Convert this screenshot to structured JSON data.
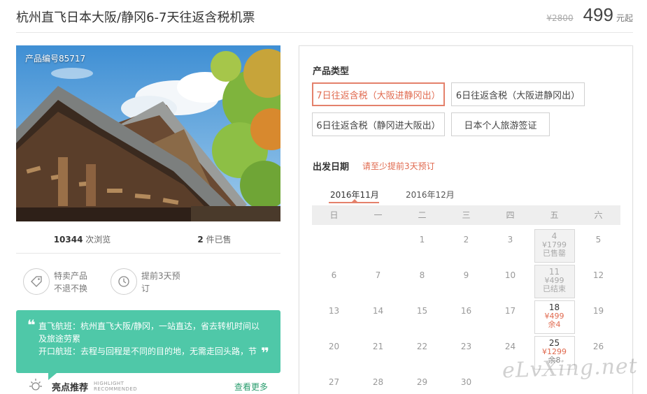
{
  "header": {
    "title": "杭州直飞日本大阪/静冈6-7天往返含税机票",
    "original_price": "¥2800",
    "price": "499",
    "price_unit": "元起"
  },
  "product": {
    "code": "产品编号85717",
    "views_count": "10344",
    "views_label": "次浏览",
    "sold_count": "2",
    "sold_label": "件已售"
  },
  "features": [
    {
      "icon": "tag-icon",
      "line1": "特卖产品",
      "line2": "不退不换"
    },
    {
      "icon": "clock-icon",
      "line1": "提前3天预",
      "line2": "订"
    }
  ],
  "highlights": {
    "line1": "直飞航班：杭州直飞大阪/静冈，一站直达，省去转机时间以",
    "line2": "及旅途劳累",
    "line3": "开口航班：去程与回程是不同的目的地，无需走回头路，节",
    "quote_open": "❝",
    "quote_close": "❞"
  },
  "recommend": {
    "label": "亮点推荐",
    "sub1": "HIGHLIGHT",
    "sub2": "RECOMMENDED",
    "more": "查看更多"
  },
  "panel": {
    "product_type_label": "产品类型",
    "options": [
      {
        "label": "7日往返含税（大阪进静冈出）",
        "selected": true
      },
      {
        "label": "6日往返含税（大阪进静冈出）",
        "selected": false
      },
      {
        "label": "6日往返含税（静冈进大阪出）",
        "selected": false
      },
      {
        "label": "日本个人旅游签证",
        "selected": false
      }
    ],
    "departure_label": "出发日期",
    "departure_note": "请至少提前3天预订",
    "months": [
      "2016年11月",
      "2016年12月"
    ],
    "weekdays": [
      "日",
      "一",
      "二",
      "三",
      "四",
      "五",
      "六"
    ],
    "calendar": [
      {
        "day": "1"
      },
      {
        "day": "2"
      },
      {
        "day": "3"
      },
      {
        "day": "4",
        "price": "¥1799",
        "status": "已售罄",
        "state": "past"
      },
      {
        "day": "5"
      },
      {
        "day": "6"
      },
      {
        "day": "7"
      },
      {
        "day": "8"
      },
      {
        "day": "9"
      },
      {
        "day": "10"
      },
      {
        "day": "11",
        "price": "¥499",
        "status": "已结束",
        "state": "past"
      },
      {
        "day": "12"
      },
      {
        "day": "13"
      },
      {
        "day": "14"
      },
      {
        "day": "15"
      },
      {
        "day": "16"
      },
      {
        "day": "17"
      },
      {
        "day": "18",
        "price": "¥499",
        "status": "余4",
        "state": "avail"
      },
      {
        "day": "19"
      },
      {
        "day": "20"
      },
      {
        "day": "21"
      },
      {
        "day": "22"
      },
      {
        "day": "23"
      },
      {
        "day": "24"
      },
      {
        "day": "25",
        "price": "¥1299",
        "status": "余8",
        "state": "avail"
      },
      {
        "day": "26"
      },
      {
        "day": "27"
      },
      {
        "day": "28"
      },
      {
        "day": "29"
      },
      {
        "day": "30"
      }
    ]
  },
  "watermark": "eLvXing.net"
}
